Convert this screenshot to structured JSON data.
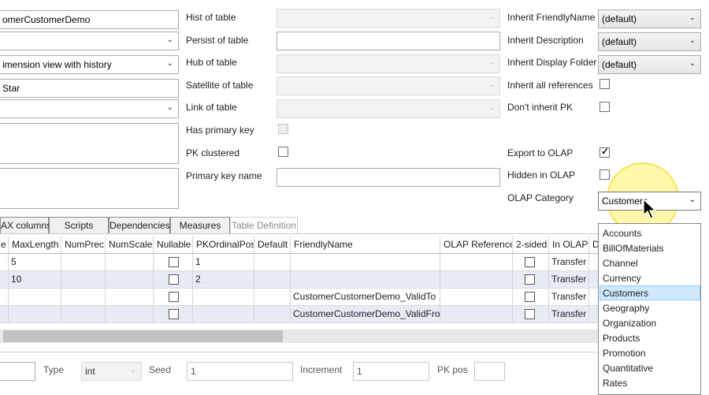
{
  "left_fields": {
    "name_value": "omerCustomerDemo",
    "dimension_type_value": "imension view with history",
    "star_value": "Star"
  },
  "middle_labels": {
    "hist": "Hist of table",
    "persist": "Persist of table",
    "hub": "Hub of table",
    "satellite": "Satellite of table",
    "link": "Link of table",
    "has_pk": "Has primary key",
    "pk_clustered": "PK clustered",
    "pk_name": "Primary key name"
  },
  "right_labels": {
    "inherit_friendly": "Inherit FriendlyName",
    "inherit_desc": "Inherit Description",
    "inherit_folder": "Inherit Display Folder",
    "inherit_refs": "Inherit all references",
    "dont_inherit_pk": "Don't inherit PK",
    "export_olap": "Export to OLAP",
    "hidden_olap": "Hidden in OLAP",
    "olap_category": "OLAP Category"
  },
  "right_values": {
    "friendly": "(default)",
    "desc": "(default)",
    "folder": "(default)",
    "olap_category": "Customers"
  },
  "tabs": [
    {
      "label": "AX columns"
    },
    {
      "label": "Scripts"
    },
    {
      "label": "Dependencies"
    },
    {
      "label": "Measures"
    },
    {
      "label": "Table Definition"
    }
  ],
  "grid": {
    "headers": [
      "e",
      "MaxLength",
      "NumPrec",
      "NumScale",
      "Nullable",
      "PKOrdinalPos",
      "Default",
      "FriendlyName",
      "OLAP Reference",
      "2-sided",
      "In OLAP",
      "D"
    ],
    "rows": [
      {
        "maxlength": "5",
        "pkpos": "1",
        "friendly": "",
        "inolap": "Transfer"
      },
      {
        "maxlength": "10",
        "pkpos": "2",
        "friendly": "",
        "inolap": "Transfer"
      },
      {
        "maxlength": "",
        "pkpos": "",
        "friendly": "CustomerCustomerDemo_ValidTo",
        "inolap": "Transfer"
      },
      {
        "maxlength": "",
        "pkpos": "",
        "friendly": "CustomerCustomerDemo_ValidFrom",
        "inolap": "Transfer"
      }
    ]
  },
  "bottom": {
    "type_label": "Type",
    "type_value": "int",
    "seed_label": "Seed",
    "seed_value": "1",
    "increment_label": "Increment",
    "increment_value": "1",
    "pkpos_label": "PK pos"
  },
  "olap_dropdown": {
    "items": [
      "Accounts",
      "BillOfMaterials",
      "Channel",
      "Currency",
      "Customers",
      "Geography",
      "Organization",
      "Products",
      "Promotion",
      "Quantitative",
      "Rates"
    ],
    "selected": "Customers"
  },
  "colors": {
    "selection": "#cde8ff",
    "row_alt": "#e9ebf4",
    "cursor_highlight": "#fff59a"
  }
}
